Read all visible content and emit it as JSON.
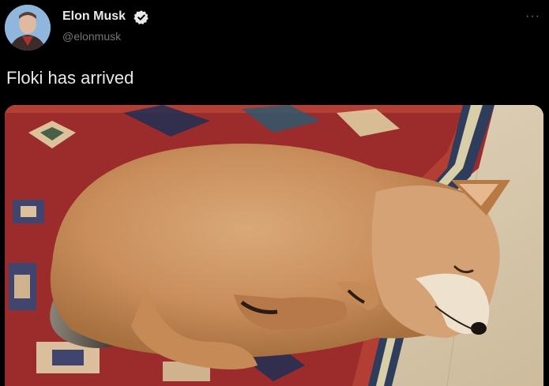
{
  "author": {
    "name": "Elon Musk",
    "handle": "@elonmusk",
    "verified_icon": "verified-badge-icon",
    "avatar_icon": "profile-avatar"
  },
  "menu": {
    "icon": "more-options-icon",
    "label": "···"
  },
  "tweet": {
    "text": "Floki has arrived"
  },
  "media": {
    "subject": "shiba-inu-puppy-sleeping-on-rug"
  },
  "colors": {
    "background": "#000000",
    "name": "#e7e9ea",
    "handle": "#71767b",
    "verified": "#e7e9ea"
  }
}
